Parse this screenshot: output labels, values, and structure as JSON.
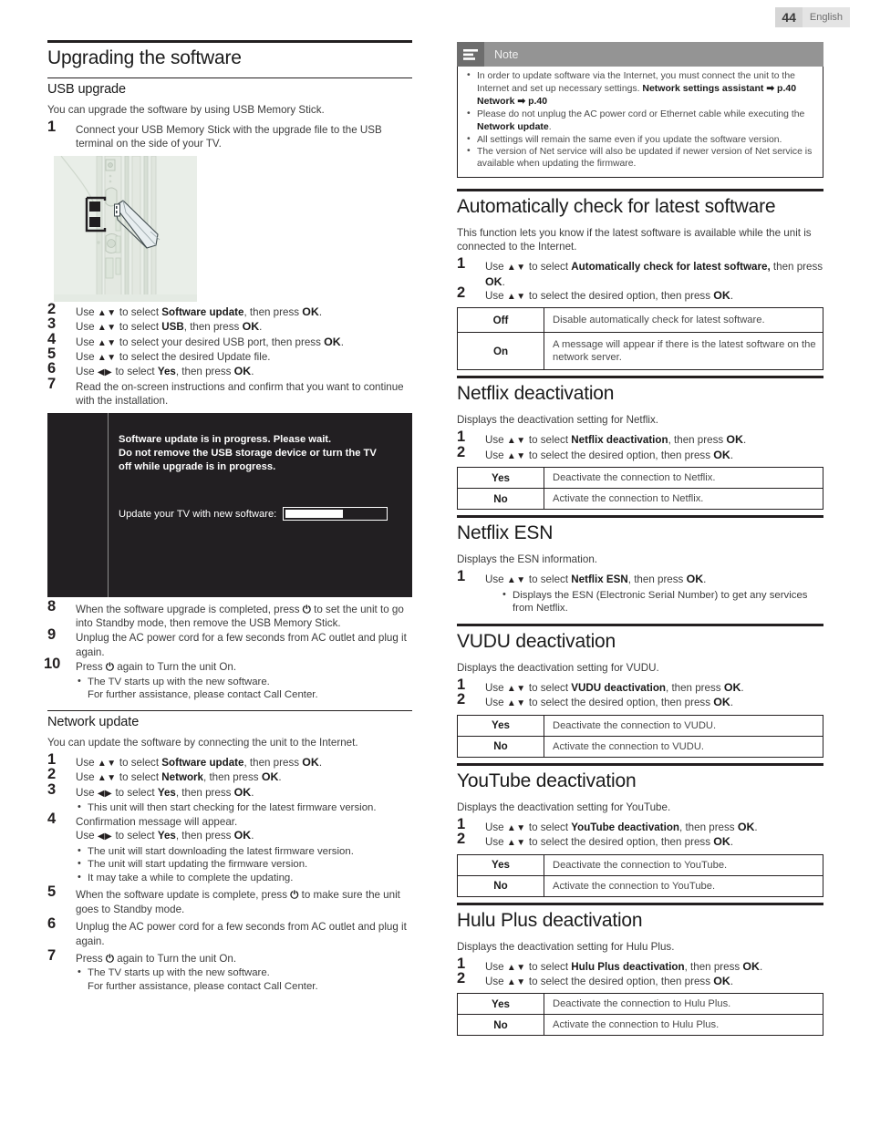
{
  "page_header": {
    "page_number": "44",
    "language": "English"
  },
  "left_column": {
    "section_title": "Upgrading the software",
    "usb": {
      "heading": "USB upgrade",
      "intro": "You can upgrade the software by using USB Memory Stick.",
      "steps": [
        {
          "num": "1",
          "text_parts": [
            "Connect your USB Memory Stick with the upgrade file to the USB terminal on the side of your TV."
          ]
        },
        {
          "num": "2",
          "pre": "Use ",
          "arrows": "▲▼",
          "mid": " to select ",
          "bold": "Software update",
          "post": ", then press ",
          "ok": "OK",
          "end": "."
        },
        {
          "num": "3",
          "pre": "Use ",
          "arrows": "▲▼",
          "mid": " to select ",
          "bold": "USB",
          "post": ", then press ",
          "ok": "OK",
          "end": "."
        },
        {
          "num": "4",
          "pre": "Use ",
          "arrows": "▲▼",
          "mid": " to select your desired USB port, then press ",
          "bold": "",
          "post": "",
          "ok": "OK",
          "end": "."
        },
        {
          "num": "5",
          "pre": "Use ",
          "arrows": "▲▼",
          "mid": " to select the desired Update file.",
          "bold": "",
          "post": "",
          "ok": "",
          "end": ""
        },
        {
          "num": "6",
          "pre": "Use ",
          "arrows": "◀▶",
          "mid": " to select ",
          "bold": "Yes",
          "post": ", then press ",
          "ok": "OK",
          "end": "."
        },
        {
          "num": "7",
          "text_parts": [
            "Read the on-screen instructions and confirm that you want to continue with the installation."
          ]
        }
      ],
      "screen_mock": {
        "line1": "Software update is in progress. Please wait.",
        "line2": "Do not remove the USB storage device or turn the TV off while upgrade is in progress.",
        "progress_label": "Update your TV with new software:",
        "progress_percent": 58
      },
      "steps_after": [
        {
          "num": "8",
          "a": "When the software upgrade is completed, press ",
          "power": "⏻",
          "b": " to set the unit to go into Standby mode, then remove the USB Memory Stick."
        },
        {
          "num": "9",
          "a": "Unplug the AC power cord for a few seconds from AC outlet and plug it again.",
          "power": "",
          "b": ""
        },
        {
          "num": "10",
          "a": "Press ",
          "power": "⏻",
          "b": " again to Turn the unit On.",
          "bullets": [
            "The TV starts up with the new software.",
            "For further assistance, please contact Call Center."
          ]
        }
      ]
    },
    "network": {
      "heading": "Network update",
      "intro": "You can update the software by connecting the unit to the Internet.",
      "steps": [
        {
          "num": "1",
          "pre": "Use ",
          "arrows": "▲▼",
          "mid": " to select ",
          "bold": "Software update",
          "post": ", then press ",
          "ok": "OK",
          "end": "."
        },
        {
          "num": "2",
          "pre": "Use ",
          "arrows": "▲▼",
          "mid": " to select ",
          "bold": "Network",
          "post": ", then press ",
          "ok": "OK",
          "end": "."
        },
        {
          "num": "3",
          "pre": "Use ",
          "arrows": "◀▶",
          "mid": " to select ",
          "bold": "Yes",
          "post": ", then press ",
          "ok": "OK",
          "end": ".",
          "bullets": [
            "This unit will then start checking for the latest firmware version."
          ]
        },
        {
          "num": "4",
          "line1": "Confirmation message will appear.",
          "pre": "Use ",
          "arrows": "◀▶",
          "mid": " to select ",
          "bold": "Yes",
          "post": ", then press ",
          "ok": "OK",
          "end": ".",
          "bullets": [
            "The unit will start downloading the latest firmware version.",
            "The unit will start updating the firmware version.",
            "It may take a while to complete the updating."
          ]
        },
        {
          "num": "5",
          "a": "When the software update is complete, press ",
          "power": "⏻",
          "b": " to make sure the unit goes to Standby mode."
        },
        {
          "num": "6",
          "a": "Unplug the AC power cord for a few seconds from AC outlet and plug it again.",
          "power": "",
          "b": ""
        },
        {
          "num": "7",
          "a": "Press ",
          "power": "⏻",
          "b": " again to Turn the unit On.",
          "bullets": [
            "The TV starts up with the new software.",
            "For further assistance, please contact Call Center."
          ]
        }
      ]
    }
  },
  "right_column": {
    "note": {
      "title": "Note",
      "icon": "note-lines-icon",
      "items": [
        {
          "text_a": "In order to update software via the Internet, you must connect the unit to the Internet and set up necessary settings. ",
          "bold_a": "Network settings assistant",
          "ref_a": " ➡ p.40 ",
          "bold_b": "Network",
          "ref_b": " ➡ p.40"
        },
        {
          "text_a": "Please do not unplug the AC power cord or Ethernet cable while executing the ",
          "bold_a": "Network update",
          "ref_a": ".",
          "bold_b": "",
          "ref_b": ""
        },
        {
          "text_a": "All settings will remain the same even if you update the software version.",
          "bold_a": "",
          "ref_a": "",
          "bold_b": "",
          "ref_b": ""
        },
        {
          "text_a": "The version of Net service will also be updated if newer version of Net service is available when updating the firmware.",
          "bold_a": "",
          "ref_a": "",
          "bold_b": "",
          "ref_b": ""
        }
      ]
    },
    "sections": [
      {
        "title": "Automatically check for latest software",
        "intro": "This function lets you know if the latest software is available while the unit is connected to the Internet.",
        "steps": [
          {
            "num": "1",
            "pre": "Use ",
            "arrows": "▲▼",
            "mid": " to select ",
            "bold": "Automatically check for latest software,",
            "post": " then press ",
            "ok": "OK",
            "end": "."
          },
          {
            "num": "2",
            "pre": "Use ",
            "arrows": "▲▼",
            "mid": " to select the desired option, then press ",
            "bold": "",
            "post": "",
            "ok": "OK",
            "end": "."
          }
        ],
        "table": [
          {
            "key": "Off",
            "value": "Disable automatically check for latest software."
          },
          {
            "key": "On",
            "value": "A message will appear if there is the latest software on the network server."
          }
        ]
      },
      {
        "title": "Netflix deactivation",
        "intro": "Displays the deactivation setting for Netflix.",
        "steps": [
          {
            "num": "1",
            "pre": "Use ",
            "arrows": "▲▼",
            "mid": " to select ",
            "bold": "Netflix deactivation",
            "post": ", then press ",
            "ok": "OK",
            "end": "."
          },
          {
            "num": "2",
            "pre": "Use ",
            "arrows": "▲▼",
            "mid": " to select the desired option, then press ",
            "bold": "",
            "post": "",
            "ok": "OK",
            "end": "."
          }
        ],
        "table": [
          {
            "key": "Yes",
            "value": "Deactivate the connection to Netflix."
          },
          {
            "key": "No",
            "value": "Activate the connection to Netflix."
          }
        ]
      },
      {
        "title": "Netflix ESN",
        "intro": "Displays the ESN information.",
        "steps": [
          {
            "num": "1",
            "pre": "Use ",
            "arrows": "▲▼",
            "mid": " to select ",
            "bold": "Netflix ESN",
            "post": ", then press ",
            "ok": "OK",
            "end": ".",
            "bullets": [
              "Displays the ESN (Electronic Serial Number) to get any services from Netflix."
            ]
          }
        ],
        "table": []
      },
      {
        "title": "VUDU deactivation",
        "intro": "Displays the deactivation setting for VUDU.",
        "steps": [
          {
            "num": "1",
            "pre": "Use ",
            "arrows": "▲▼",
            "mid": " to select ",
            "bold": "VUDU deactivation",
            "post": ", then press ",
            "ok": "OK",
            "end": "."
          },
          {
            "num": "2",
            "pre": "Use ",
            "arrows": "▲▼",
            "mid": " to select the desired option, then press ",
            "bold": "",
            "post": "",
            "ok": "OK",
            "end": "."
          }
        ],
        "table": [
          {
            "key": "Yes",
            "value": "Deactivate the connection to VUDU."
          },
          {
            "key": "No",
            "value": "Activate the connection to VUDU."
          }
        ]
      },
      {
        "title": "YouTube deactivation",
        "intro": "Displays the deactivation setting for YouTube.",
        "steps": [
          {
            "num": "1",
            "pre": "Use ",
            "arrows": "▲▼",
            "mid": " to select ",
            "bold": "YouTube deactivation",
            "post": ", then press ",
            "ok": "OK",
            "end": "."
          },
          {
            "num": "2",
            "pre": "Use ",
            "arrows": "▲▼",
            "mid": " to select the desired option, then press ",
            "bold": "",
            "post": "",
            "ok": "OK",
            "end": "."
          }
        ],
        "table": [
          {
            "key": "Yes",
            "value": "Deactivate the connection to YouTube."
          },
          {
            "key": "No",
            "value": "Activate the connection to YouTube."
          }
        ]
      },
      {
        "title": "Hulu Plus deactivation",
        "intro": "Displays the deactivation setting for Hulu Plus.",
        "steps": [
          {
            "num": "1",
            "pre": "Use ",
            "arrows": "▲▼",
            "mid": " to select ",
            "bold": "Hulu Plus deactivation",
            "post": ", then press ",
            "ok": "OK",
            "end": "."
          },
          {
            "num": "2",
            "pre": "Use ",
            "arrows": "▲▼",
            "mid": " to select the desired option, then press ",
            "bold": "",
            "post": "",
            "ok": "OK",
            "end": "."
          }
        ],
        "table": [
          {
            "key": "Yes",
            "value": "Deactivate the connection to Hulu Plus."
          },
          {
            "key": "No",
            "value": "Activate the connection to Hulu Plus."
          }
        ]
      }
    ]
  },
  "colors": {
    "ink": "#231f20",
    "body_text": "#3c3c3c",
    "note_header": "#949494",
    "note_icon_box": "#6d6d6d",
    "illustration_bg": "#e9eee8",
    "screen_bg": "#221f22",
    "page_num_bg": "#d6d6d6"
  }
}
